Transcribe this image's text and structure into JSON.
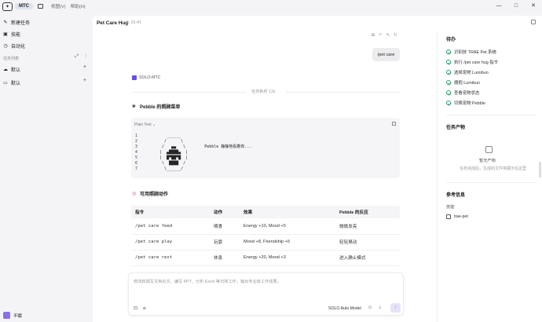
{
  "titlebar": {
    "app_name": "MTC",
    "menu_view": "视图(V)",
    "menu_help": "帮助(H)",
    "win_minimize": "—",
    "win_maximize": "□",
    "win_close": "✕"
  },
  "sidebar": {
    "new_task": "新建任务",
    "skills": "技能",
    "automation": "自动化",
    "task_list_label": "任务列表",
    "groups": [
      {
        "label": "默认"
      },
      {
        "label": "默认"
      }
    ],
    "user_name": "不眠"
  },
  "header": {
    "title": "Pet Care Hug",
    "time": "15:41"
  },
  "chat": {
    "user_message": "/pet care",
    "agent_name": "SOLO-MTC",
    "task_time": "任务耗时 13s",
    "section1_title": "Pebble 的照顾菜单",
    "code_lang": "Plain Text",
    "code_line_numbers": "1\n2\n3\n4\n5\n6\n7",
    "code_art": "       ______\n      /      \\\n     /   ▄▄   \\        Pebble 静静地看着你...\n    |  ▄████▄  |\n    |  █▀██▀█  |\n     \\  ████  /\n      \\______/",
    "section2_title": "可用照顾动作",
    "table": {
      "headers": [
        "指令",
        "动作",
        "效果",
        "Pebble 的反应"
      ],
      "rows": [
        [
          "/pet care feed",
          "喂食",
          "Energy +10, Mood +5",
          "微微发亮"
        ],
        [
          "/pet care play",
          "玩耍",
          "Mood +8, Friendship +5",
          "轻轻晃动"
        ],
        [
          "/pet care rest",
          "休息",
          "Energy +20, Mood +3",
          "进入静止模式"
        ]
      ]
    }
  },
  "input": {
    "placeholder": "修改和撰写文档论文、编写 PPT、分析 Excel 等日常工作，输出专业级工作成果。",
    "model": "SOLO Auto Model"
  },
  "right_panel": {
    "todo_title": "待办",
    "todos": [
      "识别技 TRAE Pet 系统",
      "执行 /pet care hug 指令",
      "选择宠物 Lumibun",
      "拥抱 Lumibun",
      "查看宠物状态",
      "切换宠物 Pebble"
    ],
    "products_title": "任务产物",
    "empty_title": "暂无产物",
    "empty_desc": "任务完成后，生成的文件将展示在这里",
    "ref_title": "参考信息",
    "skill_label": "技能",
    "skill_item": "trae-pet"
  },
  "colors": {
    "accent": "#6b5bd6",
    "success": "#2aa36b"
  }
}
